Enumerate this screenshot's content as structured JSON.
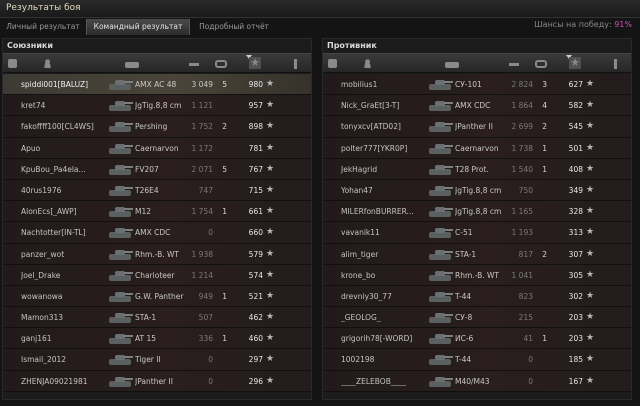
{
  "window": {
    "title": "Результаты боя"
  },
  "tabs": [
    {
      "label": "Личный результат"
    },
    {
      "label": "Командный результат"
    },
    {
      "label": "Подробный отчёт"
    }
  ],
  "win_chance": {
    "label": "Шансы на победу:",
    "value": "91%"
  },
  "allies": {
    "title": "Союзники",
    "rows": [
      {
        "player": "spiddi001[BALUZ]",
        "vehicle": "AMX AC 48",
        "damage": "3 049",
        "kills": "5",
        "xp": "980"
      },
      {
        "player": "kret74",
        "vehicle": "JgTig.8,8 cm",
        "damage": "1 121",
        "kills": "",
        "xp": "957"
      },
      {
        "player": "fakoffff100[CL4WS]",
        "vehicle": "Pershing",
        "damage": "1 752",
        "kills": "2",
        "xp": "898"
      },
      {
        "player": "Apuo",
        "vehicle": "Caernarvon",
        "damage": "1 172",
        "kills": "",
        "xp": "781"
      },
      {
        "player": "KpuBou_Pa4ela...",
        "vehicle": "FV207",
        "damage": "2 071",
        "kills": "5",
        "xp": "767"
      },
      {
        "player": "40rus1976",
        "vehicle": "T26E4",
        "damage": "747",
        "kills": "",
        "xp": "715"
      },
      {
        "player": "AlonEcs[_AWP]",
        "vehicle": "M12",
        "damage": "1 754",
        "kills": "1",
        "xp": "661"
      },
      {
        "player": "Nachtotter[IN-TL]",
        "vehicle": "AMX CDC",
        "damage": "0",
        "kills": "",
        "xp": "660"
      },
      {
        "player": "panzer_wot",
        "vehicle": "Rhm.-B. WT",
        "damage": "1 938",
        "kills": "",
        "xp": "579"
      },
      {
        "player": "Joel_Drake",
        "vehicle": "Charioteer",
        "damage": "1 214",
        "kills": "",
        "xp": "574"
      },
      {
        "player": "wowanowa",
        "vehicle": "G.W. Panther",
        "damage": "949",
        "kills": "1",
        "xp": "521"
      },
      {
        "player": "Mamon313",
        "vehicle": "STA-1",
        "damage": "507",
        "kills": "",
        "xp": "462"
      },
      {
        "player": "ganj161",
        "vehicle": "AT 15",
        "damage": "336",
        "kills": "1",
        "xp": "460"
      },
      {
        "player": "Ismail_2012",
        "vehicle": "Tiger II",
        "damage": "0",
        "kills": "",
        "xp": "297"
      },
      {
        "player": "ZHENJA09021981",
        "vehicle": "JPanther II",
        "damage": "0",
        "kills": "",
        "xp": "296"
      }
    ]
  },
  "enemies": {
    "title": "Противник",
    "rows": [
      {
        "player": "mobilius1",
        "vehicle": "СУ-101",
        "damage": "2 824",
        "kills": "3",
        "xp": "627"
      },
      {
        "player": "Nick_GraEt[3-T]",
        "vehicle": "AMX CDC",
        "damage": "1 864",
        "kills": "4",
        "xp": "582"
      },
      {
        "player": "tonyxcv[ATD02]",
        "vehicle": "JPanther II",
        "damage": "2 699",
        "kills": "2",
        "xp": "545"
      },
      {
        "player": "polter777[YKR0P]",
        "vehicle": "Caernarvon",
        "damage": "1 738",
        "kills": "1",
        "xp": "501"
      },
      {
        "player": "JekHagrid",
        "vehicle": "T28 Prot.",
        "damage": "1 540",
        "kills": "1",
        "xp": "408"
      },
      {
        "player": "Yohan47",
        "vehicle": "JgTig.8,8 cm",
        "damage": "750",
        "kills": "",
        "xp": "349"
      },
      {
        "player": "MILERfonBURRER...",
        "vehicle": "JgTig.8,8 cm",
        "damage": "1 165",
        "kills": "",
        "xp": "328"
      },
      {
        "player": "vavanik11",
        "vehicle": "С-51",
        "damage": "1 193",
        "kills": "",
        "xp": "313"
      },
      {
        "player": "alim_tiger",
        "vehicle": "STA-1",
        "damage": "817",
        "kills": "2",
        "xp": "307"
      },
      {
        "player": "krone_bo",
        "vehicle": "Rhm.-B. WT",
        "damage": "1 041",
        "kills": "",
        "xp": "305"
      },
      {
        "player": "drevniy30_77",
        "vehicle": "T-44",
        "damage": "823",
        "kills": "",
        "xp": "302"
      },
      {
        "player": "_GEOLOG_",
        "vehicle": "СУ-8",
        "damage": "215",
        "kills": "",
        "xp": "203"
      },
      {
        "player": "grigorih78[-WORD]",
        "vehicle": "ИС-6",
        "damage": "41",
        "kills": "1",
        "xp": "203"
      },
      {
        "player": "1002198",
        "vehicle": "T-44",
        "damage": "0",
        "kills": "",
        "xp": "185"
      },
      {
        "player": "____ZELEBOB____",
        "vehicle": "M40/M43",
        "damage": "0",
        "kills": "",
        "xp": "167"
      }
    ]
  },
  "icons": {
    "star": "star-icon",
    "tank": "tank-icon"
  }
}
